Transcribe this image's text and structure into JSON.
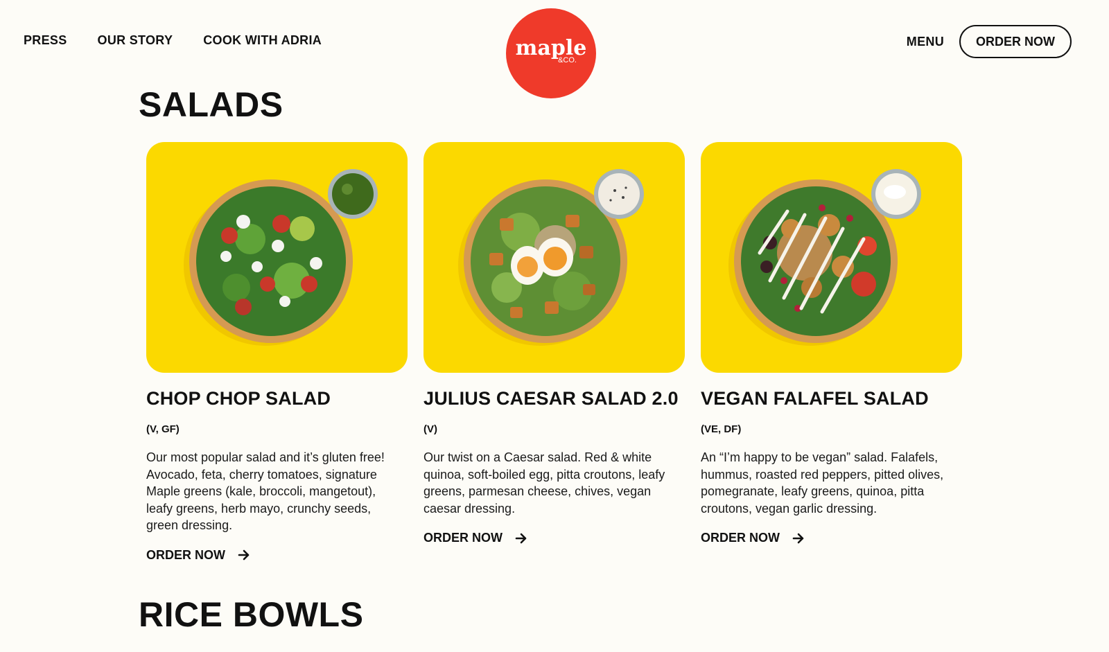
{
  "header": {
    "nav_left": [
      "PRESS",
      "OUR STORY",
      "COOK WITH ADRIA"
    ],
    "logo": {
      "word": "maple",
      "sub": "&CO."
    },
    "menu_label": "MENU",
    "order_button": "ORDER NOW"
  },
  "sections": {
    "salads_title": "SALADS",
    "rice_bowls_title": "RICE BOWLS"
  },
  "salads": [
    {
      "name": "CHOP CHOP SALAD",
      "tags": "(V, GF)",
      "description": "Our most popular salad and it’s gluten free! Avocado, feta, cherry tomatoes, signature Maple greens (kale, broccoli, mangetout), leafy greens, herb mayo, crunchy seeds, green dressing.",
      "cta": "ORDER NOW",
      "image_icon": "chop-chop-salad-bowl"
    },
    {
      "name": "JULIUS CAESAR SALAD 2.0",
      "tags": "(V)",
      "description": "Our twist on a Caesar salad. Red & white quinoa, soft-boiled egg, pitta croutons, leafy greens, parmesan cheese, chives, vegan caesar dressing.",
      "cta": "ORDER NOW",
      "image_icon": "caesar-salad-bowl"
    },
    {
      "name": "VEGAN FALAFEL SALAD",
      "tags": "(VE, DF)",
      "description": "An “I’m happy to be vegan” salad. Falafels, hummus, roasted red peppers, pitted olives, pomegranate, leafy greens, quinoa, pitta croutons, vegan garlic dressing.",
      "cta": "ORDER NOW",
      "image_icon": "falafel-salad-bowl"
    }
  ],
  "colors": {
    "background": "#fdfcf7",
    "card_background": "#fbd900",
    "logo_red": "#ef3a2a",
    "text": "#111111"
  }
}
